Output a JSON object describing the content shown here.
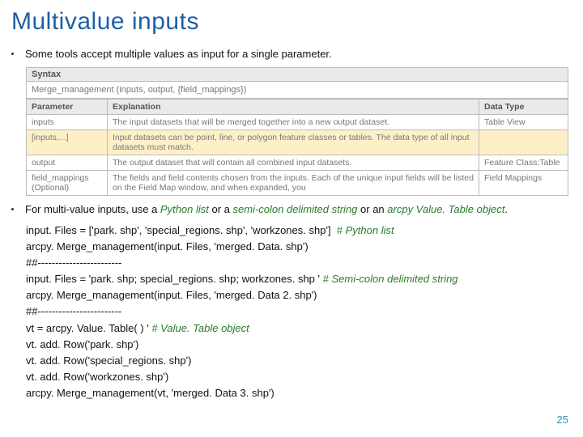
{
  "title": "Multivalue inputs",
  "bullet1": "Some tools accept multiple values as input for a single parameter.",
  "syntax_label": "Syntax",
  "syntax_sig": "Merge_management (inputs, output, {field_mappings})",
  "th": {
    "param": "Parameter",
    "expl": "Explanation",
    "dtype": "Data Type"
  },
  "rows": [
    {
      "p": "inputs",
      "e": "The input datasets that will be merged together into a new output dataset.",
      "d": "Table View"
    },
    {
      "p": "[inputs,...]",
      "e": "Input datasets can be point, line, or polygon feature classes or tables. The data type of all input datasets must match.",
      "d": ""
    },
    {
      "p": "output",
      "e": "The output dataset that will contain all combined input datasets.",
      "d": "Feature Class;Table"
    },
    {
      "p": "field_mappings",
      "e": "The fields and field contents chosen from the inputs. Each of the unique input fields will be listed on the Field Map window, and when expanded, you",
      "d": "Field Mappings"
    },
    {
      "p_opt": "(Optional)",
      "e": "",
      "d": ""
    }
  ],
  "bullet2_a": "For multi-value inputs, use a ",
  "bullet2_b": "Python list",
  "bullet2_c": " or a ",
  "bullet2_d": "semi-colon delimited string",
  "bullet2_e": " or an ",
  "bullet2_f": "arcpy Value. Table object",
  "bullet2_g": ".",
  "code": {
    "l1a": "input. Files = ['park. shp', 'special_regions. shp', 'workzones. shp']  ",
    "l1b": "# Python list",
    "l2": "arcpy. Merge_management(input. Files, 'merged. Data. shp')",
    "l3": "##------------------------",
    "l4a": "input. Files = 'park. shp; special_regions. shp; workzones. shp ' ",
    "l4b": "# Semi-colon delimited string",
    "l5": "arcpy. Merge_management(input. Files, 'merged. Data 2. shp')",
    "l6": "##------------------------",
    "l7a": "vt = arcpy. Value. Table( ) ' ",
    "l7b": "# Value. Table object",
    "l8": "vt. add. Row('park. shp')",
    "l9": "vt. add. Row('special_regions. shp')",
    "l10": "vt. add. Row('workzones. shp')",
    "l11": "arcpy. Merge_management(vt, 'merged. Data 3. shp')"
  },
  "slide_num": "25"
}
